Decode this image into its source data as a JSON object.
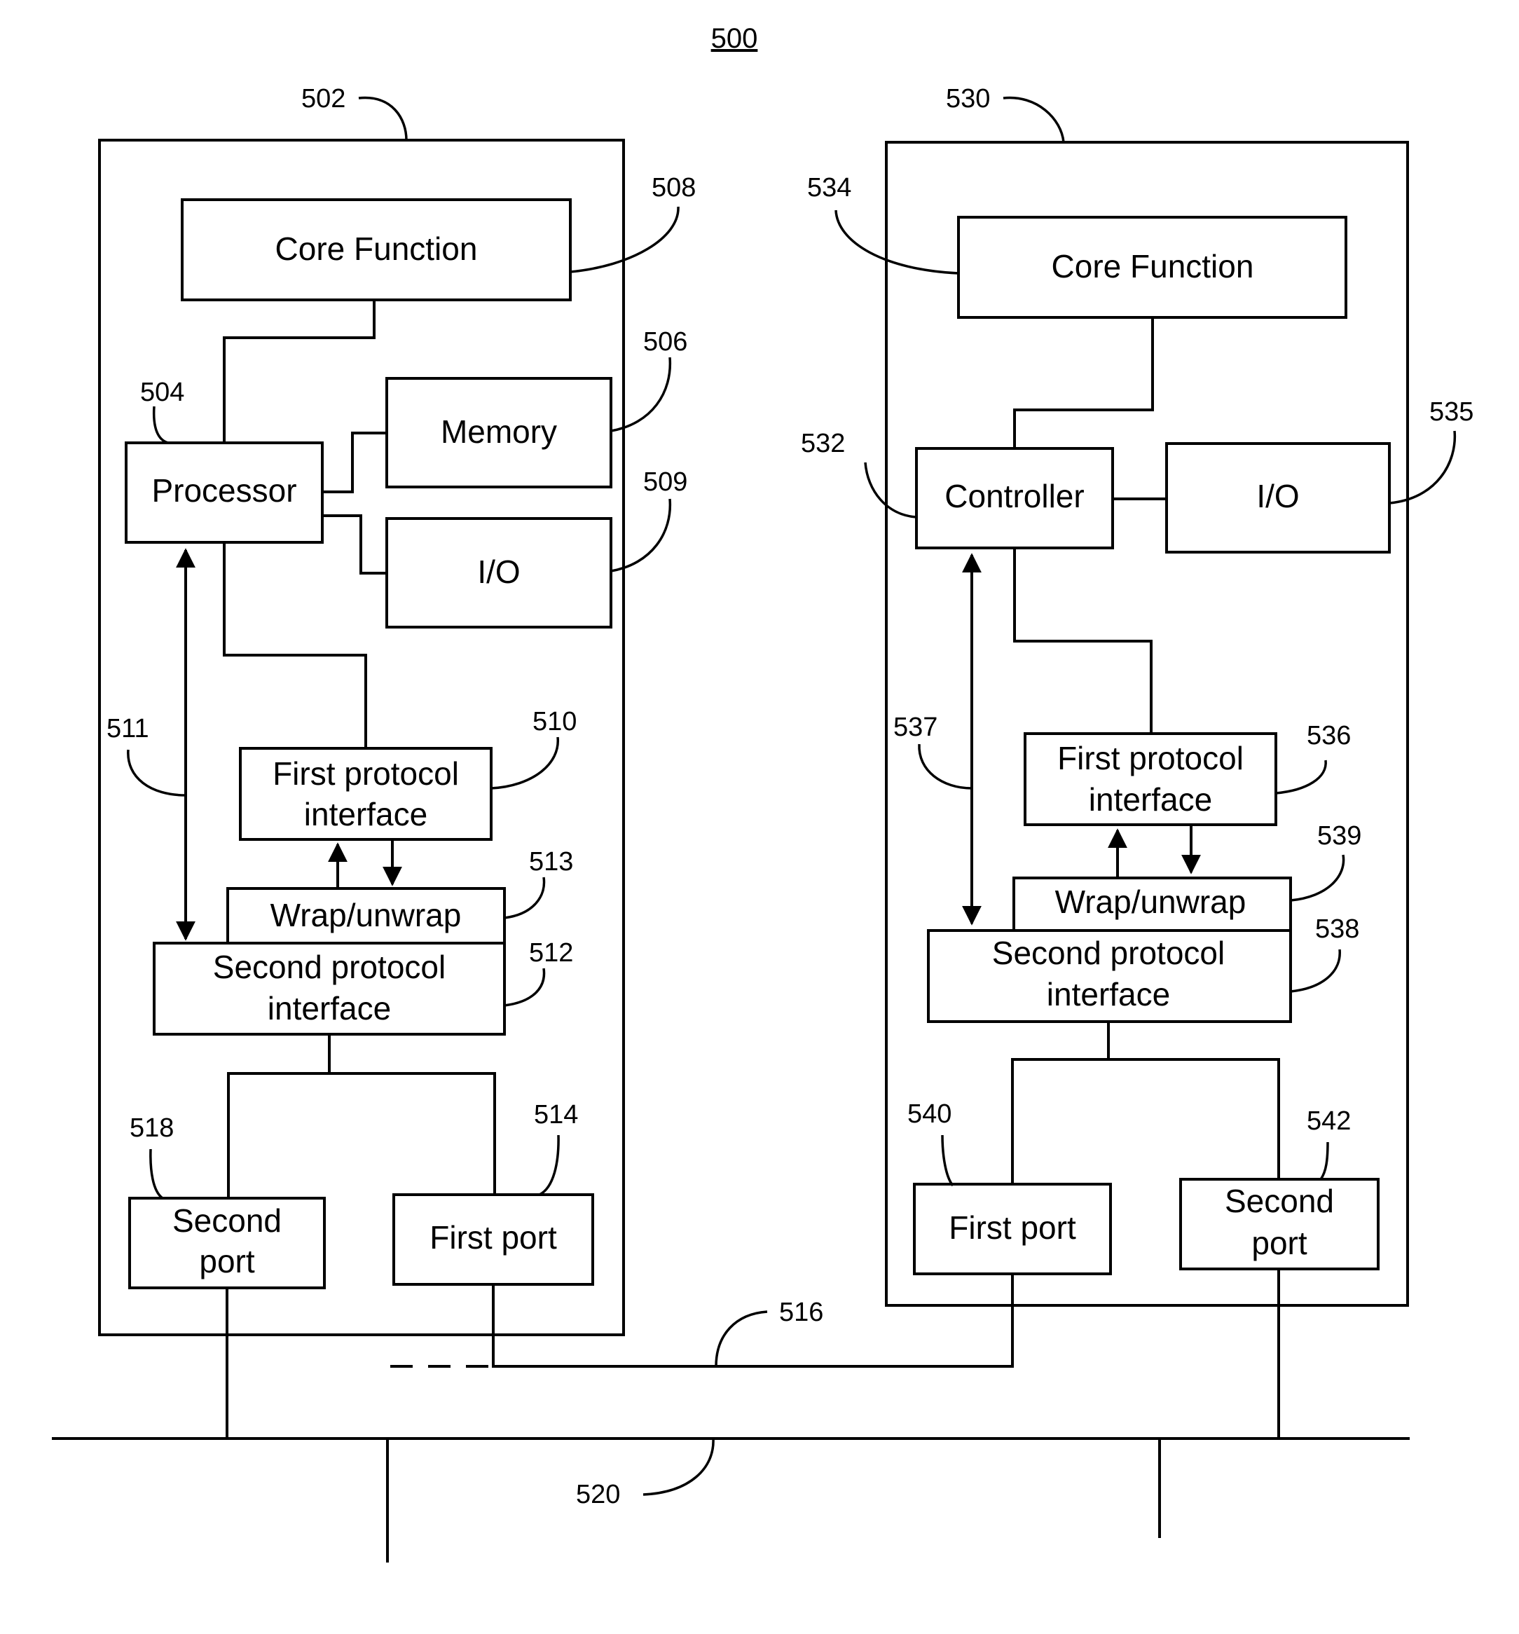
{
  "figure": {
    "number": "500"
  },
  "device_left": {
    "ref": "502",
    "core_function": {
      "label": "Core Function",
      "ref": "508"
    },
    "processor": {
      "label": "Processor",
      "ref": "504"
    },
    "memory": {
      "label": "Memory",
      "ref": "506"
    },
    "io": {
      "label": "I/O",
      "ref": "509"
    },
    "direct_path": {
      "ref": "511"
    },
    "first_protocol_interface": {
      "line1": "First protocol",
      "line2": "interface",
      "ref": "510"
    },
    "wrap_unwrap": {
      "label": "Wrap/unwrap",
      "ref": "513"
    },
    "second_protocol_interface": {
      "line1": "Second protocol",
      "line2": "interface",
      "ref": "512"
    },
    "second_port": {
      "line1": "Second",
      "line2": "port",
      "ref": "518"
    },
    "first_port": {
      "label": "First port",
      "ref": "514"
    }
  },
  "device_right": {
    "ref": "530",
    "core_function": {
      "label": "Core Function",
      "ref": "534"
    },
    "controller": {
      "label": "Controller",
      "ref": "532"
    },
    "io": {
      "label": "I/O",
      "ref": "535"
    },
    "direct_path": {
      "ref": "537"
    },
    "first_protocol_interface": {
      "line1": "First protocol",
      "line2": "interface",
      "ref": "536"
    },
    "wrap_unwrap": {
      "label": "Wrap/unwrap",
      "ref": "539"
    },
    "second_protocol_interface": {
      "line1": "Second protocol",
      "line2": "interface",
      "ref": "538"
    },
    "first_port": {
      "label": "First port",
      "ref": "540"
    },
    "second_port": {
      "line1": "Second",
      "line2": "port",
      "ref": "542"
    }
  },
  "links": {
    "point_to_point": {
      "ref": "516"
    },
    "bus": {
      "ref": "520"
    }
  }
}
